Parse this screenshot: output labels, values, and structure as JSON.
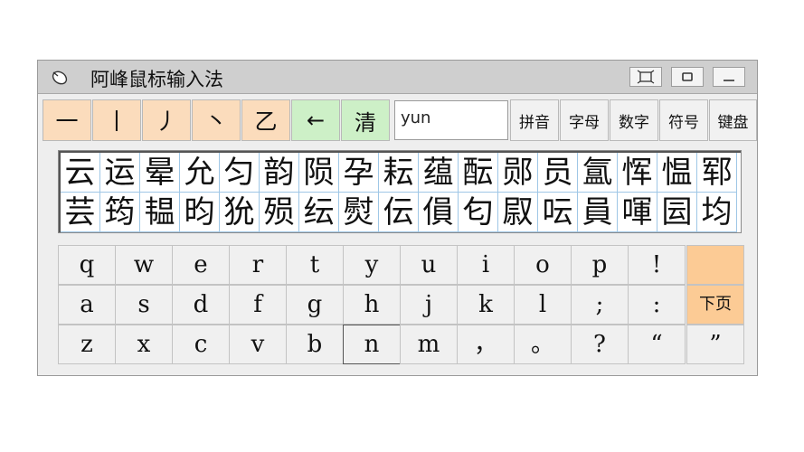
{
  "window": {
    "title": "阿峰鼠标输入法",
    "app_icon": "mouse-icon",
    "buttons": [
      "restore-icon",
      "maximize-icon",
      "minimize-icon"
    ]
  },
  "strokes": [
    "一",
    "丨",
    "丿",
    "丶",
    "乙"
  ],
  "backspace": "←",
  "clear": "清",
  "pinyin_input": "yun",
  "modes": [
    "拼音",
    "字母",
    "数字",
    "符号",
    "键盘"
  ],
  "candidates": {
    "row1": [
      "云",
      "运",
      "晕",
      "允",
      "匀",
      "韵",
      "陨",
      "孕",
      "耘",
      "蕴",
      "酝",
      "郧",
      "员",
      "氲",
      "恽",
      "愠",
      "郓"
    ],
    "row2": [
      "芸",
      "筠",
      "韫",
      "昀",
      "狁",
      "殒",
      "纭",
      "熨",
      "伝",
      "傊",
      "匂",
      "叞",
      "呍",
      "員",
      "喗",
      "囩",
      "均"
    ]
  },
  "keyboard": {
    "row1": [
      "q",
      "w",
      "e",
      "r",
      "t",
      "y",
      "u",
      "i",
      "o",
      "p",
      "!",
      ""
    ],
    "row2": [
      "a",
      "s",
      "d",
      "f",
      "g",
      "h",
      "j",
      "k",
      "l",
      ";",
      ":",
      "下页"
    ],
    "row3": [
      "z",
      "x",
      "c",
      "v",
      "b",
      "n",
      "m",
      "，",
      "。",
      "?",
      "“",
      "”"
    ]
  },
  "colors": {
    "stroke_key": "#fbdcbc",
    "action_key": "#cdf0c7",
    "page_key": "#fccb95",
    "grid_line": "#9fc7e6"
  }
}
